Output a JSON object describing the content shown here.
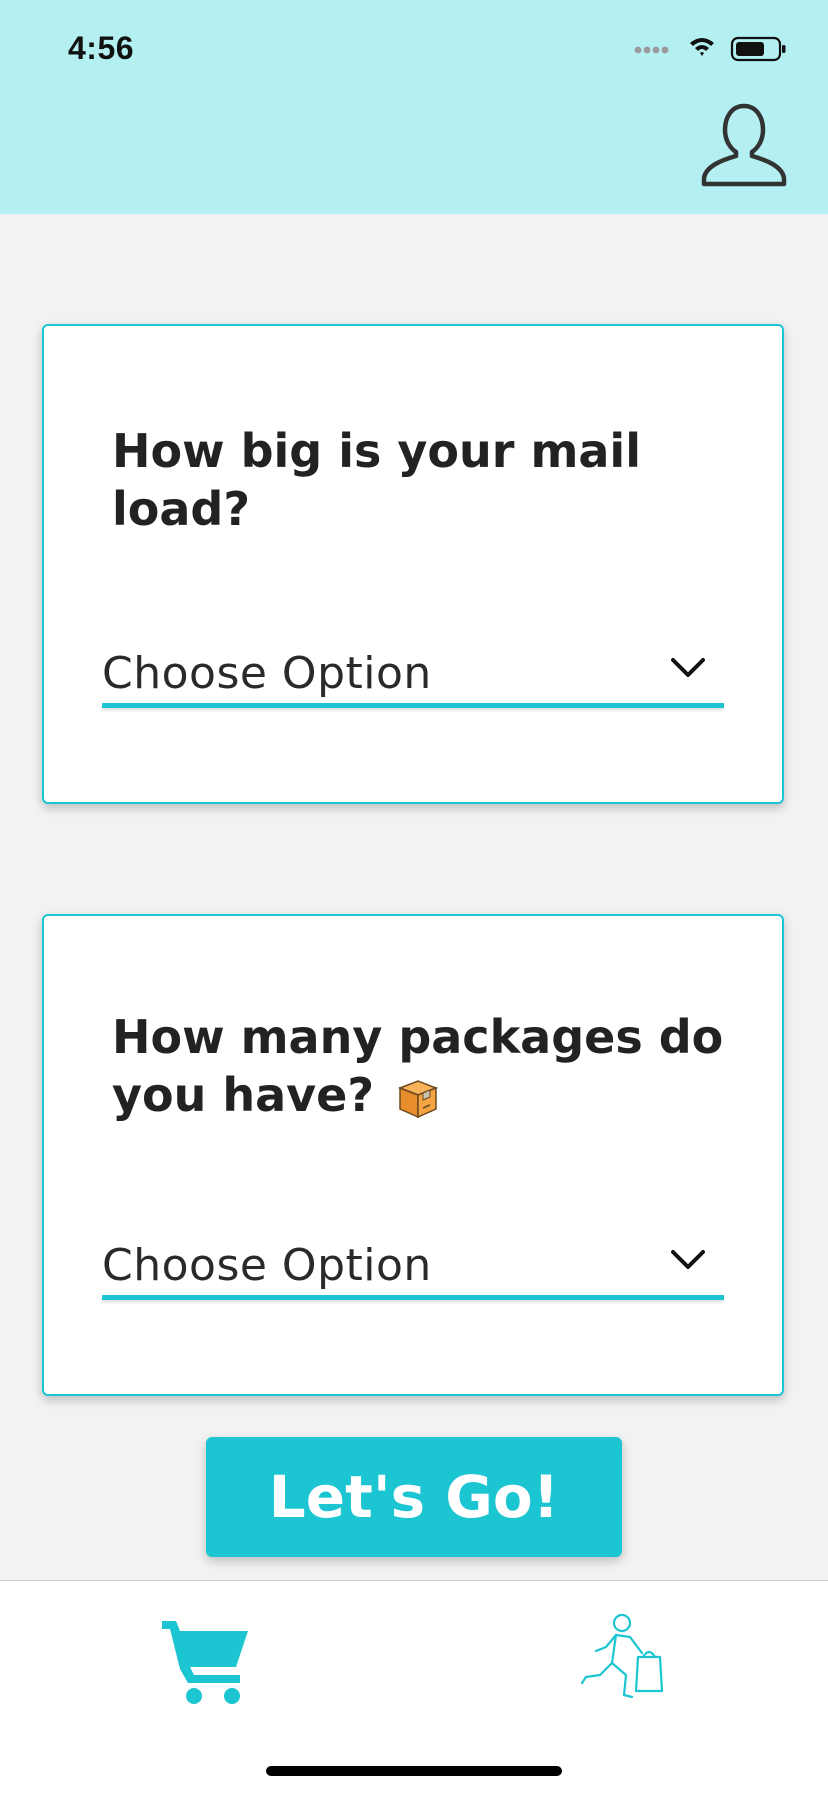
{
  "status_bar": {
    "time": "4:56",
    "icons": [
      "signal-icon",
      "wifi-icon",
      "battery-icon"
    ]
  },
  "header": {
    "profile_icon": "user-profile-icon",
    "background_color": "#b4eff2"
  },
  "cards": [
    {
      "question": "How big is your mail load?",
      "select_value": "Choose Option"
    },
    {
      "question": "How many packages do you have?",
      "emoji": "package-box-icon",
      "select_value": "Choose Option"
    }
  ],
  "cta": {
    "label": "Let's Go!"
  },
  "tab_bar": {
    "items": [
      {
        "icon": "shopping-cart-icon"
      },
      {
        "icon": "courier-runner-icon"
      }
    ]
  },
  "colors": {
    "accent": "#1bc5d1",
    "header": "#b4eff2",
    "background": "#f2f2f2"
  }
}
